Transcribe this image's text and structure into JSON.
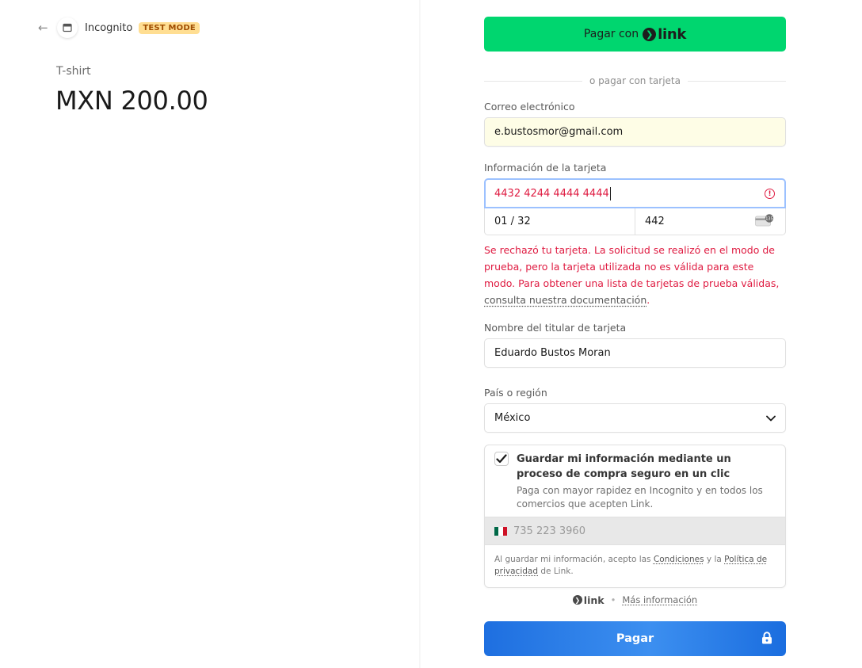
{
  "header": {
    "store_name": "Incognito",
    "badge": "TEST MODE",
    "back_icon": "arrow-left-icon",
    "store_icon": "store-icon"
  },
  "product": {
    "name": "T-shirt",
    "price": "MXN 200.00"
  },
  "link_pay": {
    "label": "Pagar con",
    "brand": "link",
    "color": "#00d66f"
  },
  "divider_text": "o pagar con tarjeta",
  "email": {
    "label": "Correo electrónico",
    "value": "e.bustosmor@gmail.com"
  },
  "card": {
    "label": "Información de la tarjeta",
    "number": "4432 4244 4444 4444",
    "expiry": "01 / 32",
    "cvc": "442",
    "error_color": "#df1b41",
    "error_text": "Se rechazó tu tarjeta. La solicitud se realizó en el modo de prueba, pero la tarjeta utilizada no es válida para este modo. Para obtener una lista de tarjetas de prueba válidas,",
    "error_link": "consulta nuestra documentación",
    "error_end": "."
  },
  "cardholder": {
    "label": "Nombre del titular de tarjeta",
    "value": "Eduardo Bustos Moran"
  },
  "country": {
    "label": "País o región",
    "value": "México"
  },
  "save_info": {
    "checked": true,
    "title": "Guardar mi información mediante un proceso de compra seguro en un clic",
    "subtitle": "Paga con mayor rapidez en Incognito y en todos los comercios que acepten Link.",
    "phone_placeholder": "735 223 3960",
    "legal_prefix": "Al guardar mi información, acepto las",
    "legal_terms": "Condiciones",
    "legal_and": "y la",
    "legal_privacy": "Política de privacidad",
    "legal_suffix": "de Link."
  },
  "link_footer": {
    "brand": "link",
    "separator": "•",
    "more_info": "Más información"
  },
  "pay_button": {
    "label": "Pagar",
    "icon": "lock-icon"
  }
}
